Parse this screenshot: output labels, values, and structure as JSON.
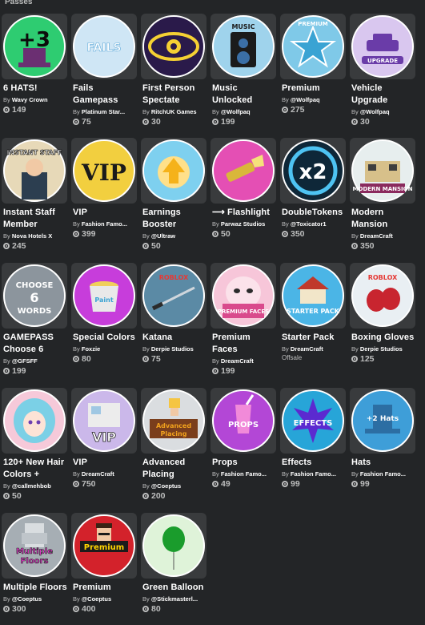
{
  "section_title": "Passes",
  "passes": [
    {
      "name": "6 HATS!",
      "by": "By",
      "creator": "Wavy Crown",
      "price": "149",
      "icon": "plus-three-hat-icon",
      "bg": "#2ecc71",
      "fg": "#0c0c0c",
      "label": "+3"
    },
    {
      "name": "Fails Gamepass",
      "by": "By",
      "creator": "Platinum Star...",
      "price": "75",
      "icon": "fails-text-icon",
      "bg": "#cfe6f5",
      "fg": "#5aa7d8",
      "label": "FAILS"
    },
    {
      "name": "First Person Spectate",
      "by": "By",
      "creator": "RitchUK Games",
      "price": "30",
      "icon": "eye-icon",
      "bg": "#2a1a4a",
      "fg": "#f5d033",
      "label": ""
    },
    {
      "name": "Music Unlocked",
      "by": "By",
      "creator": "@Wolfpaq",
      "price": "199",
      "icon": "speaker-icon",
      "bg": "#9fd3ec",
      "fg": "#1b1b1b",
      "label": "MUSIC"
    },
    {
      "name": "Premium",
      "by": "By",
      "creator": "@Wolfpaq",
      "price": "275",
      "icon": "star-icon",
      "bg": "#7fc9e8",
      "fg": "#3aa3d3",
      "label": "PREMIUM"
    },
    {
      "name": "Vehicle Upgrade",
      "by": "By",
      "creator": "@Wolfpaq",
      "price": "30",
      "icon": "car-upgrade-icon",
      "bg": "#d9c7ef",
      "fg": "#6a3ca8",
      "label": "UPGRADE"
    },
    {
      "name": "Instant Staff Member",
      "by": "By",
      "creator": "Nova Hotels X",
      "price": "245",
      "icon": "staff-avatar-icon",
      "bg": "#e7d9b8",
      "fg": "#1c1c1c",
      "label": "INSTANT STAFF"
    },
    {
      "name": "VIP",
      "by": "By",
      "creator": "Fashion Famo...",
      "price": "399",
      "icon": "vip-gold-icon",
      "bg": "#f2cf3f",
      "fg": "#1b1b1b",
      "label": "VIP"
    },
    {
      "name": "Earnings Booster",
      "by": "By",
      "creator": "@Ultraw",
      "price": "50",
      "icon": "boost-arrow-icon",
      "bg": "#7ed0ef",
      "fg": "#f5b21a",
      "label": ""
    },
    {
      "name": "⟶ Flashlight",
      "by": "By",
      "creator": "Parwaz Studios",
      "price": "50",
      "icon": "flashlight-icon",
      "bg": "#e44fb4",
      "fg": "#d9b73a",
      "label": ""
    },
    {
      "name": "DoubleTokens",
      "by": "By",
      "creator": "@Toxicator1",
      "price": "350",
      "icon": "x2-icon",
      "bg": "#0e2738",
      "fg": "#ffffff",
      "label": "x2"
    },
    {
      "name": "Modern Mansion",
      "by": "By",
      "creator": "DreamCraft",
      "price": "350",
      "icon": "mansion-icon",
      "bg": "#e7eeee",
      "fg": "#8a2a5d",
      "label": "MODERN MANSION"
    },
    {
      "name": "GAMEPASS Choose 6",
      "by": "By",
      "creator": "@GFSFF",
      "price": "199",
      "icon": "choose-six-icon",
      "bg": "#8c959d",
      "fg": "#ffffff",
      "label": "CHOOSE 6 WORDS"
    },
    {
      "name": "Special Colors",
      "by": "By",
      "creator": "Foxzie",
      "price": "80",
      "icon": "paint-bucket-icon",
      "bg": "#c73ddb",
      "fg": "#f0cf5b",
      "label": "Paint"
    },
    {
      "name": "Katana",
      "by": "By",
      "creator": "Derpie Studios",
      "price": "75",
      "icon": "katana-icon",
      "bg": "#5b8aa5",
      "fg": "#2b2b2b",
      "label": "ROBLOX"
    },
    {
      "name": "Premium Faces",
      "by": "By",
      "creator": "DreamCraft",
      "price": "199",
      "icon": "face-icon",
      "bg": "#f7c6d9",
      "fg": "#ffffff",
      "label": "PREMIUM FACES"
    },
    {
      "name": "Starter Pack",
      "by": "By",
      "creator": "DreamCraft",
      "price": "",
      "offsale": "Offsale",
      "icon": "house-icon",
      "bg": "#4bb5e6",
      "fg": "#ffffff",
      "label": "STARTER PACK"
    },
    {
      "name": "Boxing Gloves",
      "by": "By",
      "creator": "Derpie Studios",
      "price": "125",
      "icon": "boxing-glove-icon",
      "bg": "#e9eff3",
      "fg": "#c8252f",
      "label": "ROBLOX"
    },
    {
      "name": "120+ New Hair Colors +",
      "by": "By",
      "creator": "@callmehbob",
      "price": "50",
      "icon": "anime-girl-icon",
      "bg": "#f6c9d9",
      "fg": "#7bd0e6",
      "label": ""
    },
    {
      "name": "VIP",
      "by": "By",
      "creator": "DreamCraft",
      "price": "750",
      "icon": "vip-house-icon",
      "bg": "#cbb8ea",
      "fg": "#ffffff",
      "label": "VIP"
    },
    {
      "name": "Advanced Placing",
      "by": "By",
      "creator": "@Coeptus",
      "price": "200",
      "icon": "builder-icon",
      "bg": "#dadde0",
      "fg": "#f0a11d",
      "label": "Advanced Placing"
    },
    {
      "name": "Props",
      "by": "By",
      "creator": "Fashion Famo...",
      "price": "49",
      "icon": "cup-icon",
      "bg": "#b347d6",
      "fg": "#ffffff",
      "label": "PROPS"
    },
    {
      "name": "Effects",
      "by": "By",
      "creator": "Fashion Famo...",
      "price": "99",
      "icon": "effects-burst-icon",
      "bg": "#27a5d8",
      "fg": "#ffffff",
      "label": "EFFECTS"
    },
    {
      "name": "Hats",
      "by": "By",
      "creator": "Fashion Famo...",
      "price": "99",
      "icon": "top-hat-icon",
      "bg": "#3e9ed8",
      "fg": "#ffffff",
      "label": "+2 Hats"
    },
    {
      "name": "Multiple Floors",
      "by": "By",
      "creator": "@Coeptus",
      "price": "300",
      "icon": "floors-icon",
      "bg": "#a6aeb4",
      "fg": "#e53dcc",
      "label": "Multiple Floors"
    },
    {
      "name": "Premium",
      "by": "By",
      "creator": "@Coeptus",
      "price": "400",
      "icon": "premium-avatar-icon",
      "bg": "#d3222b",
      "fg": "#ffd400",
      "label": "Premium"
    },
    {
      "name": "Green Balloon",
      "by": "By",
      "creator": "@Stickmasterl...",
      "price": "80",
      "icon": "balloon-icon",
      "bg": "#dff3d9",
      "fg": "#1a9c2c",
      "label": ""
    }
  ]
}
